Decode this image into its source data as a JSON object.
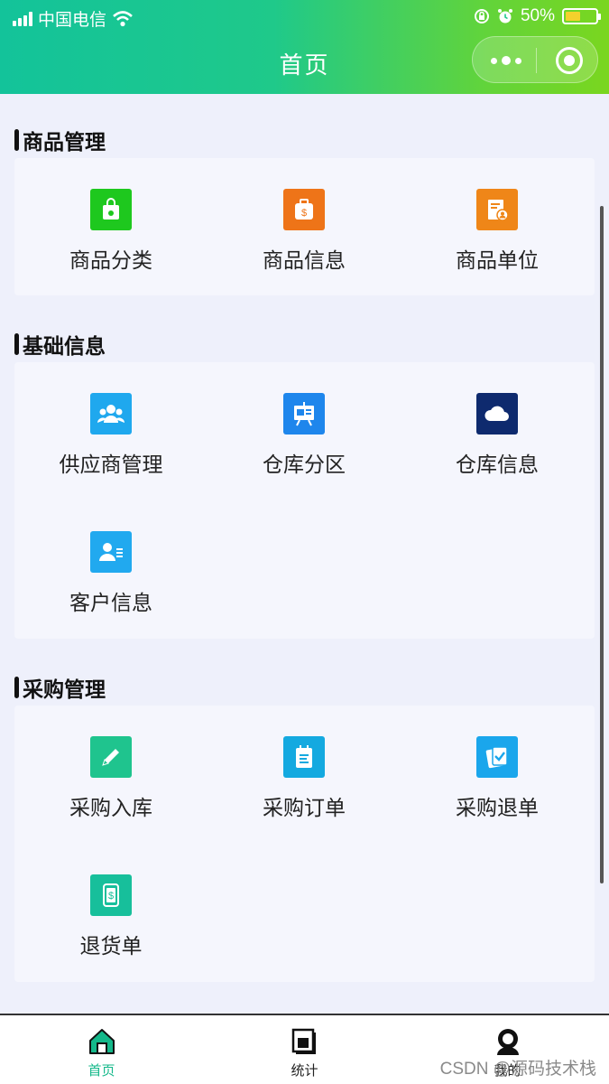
{
  "status_bar": {
    "carrier": "中国电信",
    "battery": "50%"
  },
  "nav": {
    "title": "首页"
  },
  "colors": {
    "accent": "#14b88a",
    "header_start": "#13c39a",
    "header_end": "#7ad61f"
  },
  "sections": [
    {
      "title": "商品管理",
      "items": [
        {
          "label": "商品分类",
          "icon": "shopping-bag-icon",
          "color": "#1ec81e"
        },
        {
          "label": "商品信息",
          "icon": "price-bag-icon",
          "color": "#ee7418"
        },
        {
          "label": "商品单位",
          "icon": "document-person-icon",
          "color": "#ef8618"
        }
      ]
    },
    {
      "title": "基础信息",
      "items": [
        {
          "label": "供应商管理",
          "icon": "group-icon",
          "color": "#1fa8ee"
        },
        {
          "label": "仓库分区",
          "icon": "presentation-board-icon",
          "color": "#1e86ec"
        },
        {
          "label": "仓库信息",
          "icon": "cloud-icon",
          "color": "#0e2a6e"
        },
        {
          "label": "客户信息",
          "icon": "contact-card-icon",
          "color": "#21a9ef"
        }
      ]
    },
    {
      "title": "采购管理",
      "items": [
        {
          "label": "采购入库",
          "icon": "pencil-icon",
          "color": "#1fc48e"
        },
        {
          "label": "采购订单",
          "icon": "notepad-icon",
          "color": "#14a9e0"
        },
        {
          "label": "采购退单",
          "icon": "checked-clipboard-icon",
          "color": "#1aa6ec"
        },
        {
          "label": "退货单",
          "icon": "receipt-dollar-icon",
          "color": "#17bf9b"
        }
      ]
    }
  ],
  "tabs": [
    {
      "label": "首页",
      "icon": "home-icon",
      "active": true
    },
    {
      "label": "统计",
      "icon": "stats-icon",
      "active": false
    },
    {
      "label": "我的",
      "icon": "profile-icon",
      "active": false
    }
  ],
  "watermark": "CSDN @源码技术栈"
}
